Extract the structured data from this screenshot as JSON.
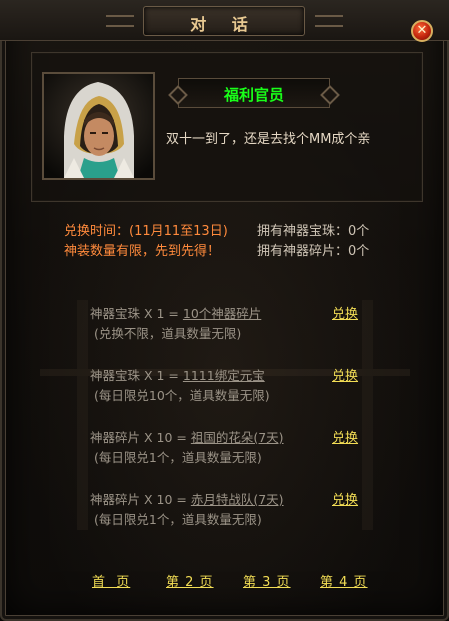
{
  "window": {
    "title": "对 话"
  },
  "npc": {
    "name": "福利官员",
    "dialogue": "双十一到了，还是去找个MM成个亲"
  },
  "info": {
    "exchange_time": "兑换时间：(11月11至13日)",
    "limited_notice": "神装数量有限，先到先得！",
    "owned_pearl": "拥有神器宝珠：0个",
    "owned_fragment": "拥有神器碎片：0个"
  },
  "items": [
    {
      "cost": "神器宝珠 X 1 = ",
      "reward": "10个神器碎片",
      "note": "(兑换不限，道具数量无限)",
      "action": "兑换"
    },
    {
      "cost": "神器宝珠 X 1 = ",
      "reward": "1111绑定元宝",
      "note": "(每日限兑10个，道具数量无限)",
      "action": "兑换"
    },
    {
      "cost": "神器碎片 X 10 = ",
      "reward": "祖国的花朵(7天)",
      "note": "(每日限兑1个，道具数量无限)",
      "action": "兑换"
    },
    {
      "cost": "神器碎片 X 10 = ",
      "reward": "赤月特战队(7天)",
      "note": "(每日限兑1个，道具数量无限)",
      "action": "兑换"
    }
  ],
  "pagination": {
    "first": "首  页",
    "page2": "第 2 页",
    "page3": "第 3 页",
    "page4": "第 4 页"
  },
  "colors": {
    "npc_name": "#19ff19",
    "link": "#f2dd55",
    "notice": "#ff8a3c",
    "close_button": "#c3260d"
  }
}
